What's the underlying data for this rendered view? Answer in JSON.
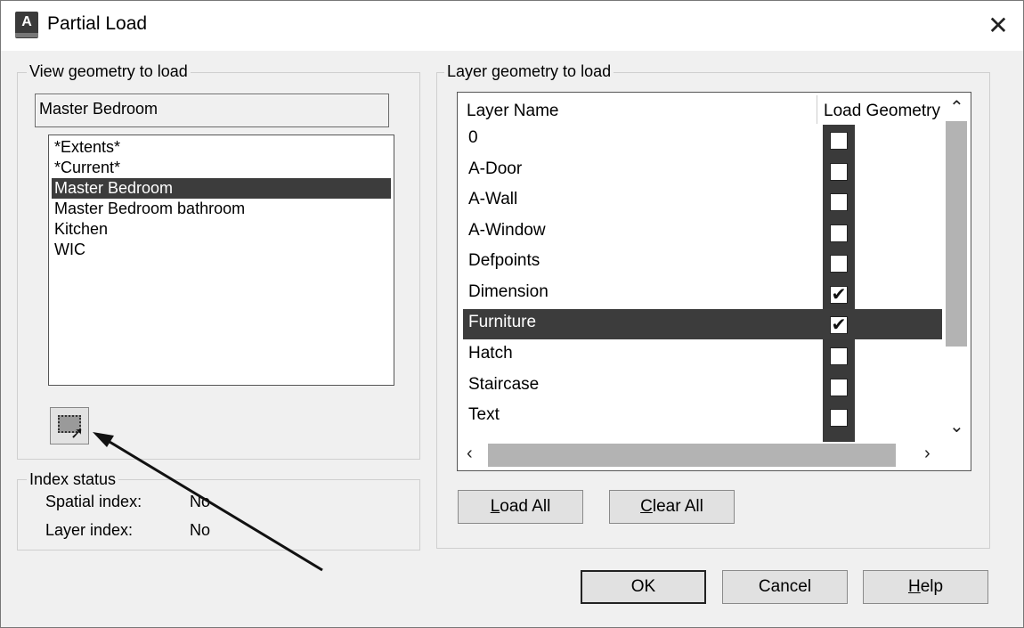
{
  "window": {
    "title": "Partial Load",
    "app_icon_letter": "A",
    "close_glyph": "✕"
  },
  "view_group": {
    "label": "View geometry to load",
    "selected_view": "Master Bedroom",
    "items": [
      {
        "label": "*Extents*",
        "selected": false
      },
      {
        "label": "*Current*",
        "selected": false
      },
      {
        "label": "Master Bedroom",
        "selected": true
      },
      {
        "label": "Master Bedroom bathroom",
        "selected": false
      },
      {
        "label": "Kitchen",
        "selected": false
      },
      {
        "label": "WIC",
        "selected": false
      }
    ],
    "pick_button_icon": "window-select-icon"
  },
  "index_status": {
    "label": "Index status",
    "spatial_label": "Spatial index:",
    "spatial_value": "No",
    "layer_label": "Layer index:",
    "layer_value": "No"
  },
  "layer_group": {
    "label": "Layer geometry to load",
    "col_name": "Layer Name",
    "col_load": "Load Geometry",
    "rows": [
      {
        "name": "0",
        "checked": false,
        "selected": false
      },
      {
        "name": "A-Door",
        "checked": false,
        "selected": false
      },
      {
        "name": "A-Wall",
        "checked": false,
        "selected": false
      },
      {
        "name": "A-Window",
        "checked": false,
        "selected": false
      },
      {
        "name": "Defpoints",
        "checked": false,
        "selected": false
      },
      {
        "name": "Dimension",
        "checked": true,
        "selected": false
      },
      {
        "name": "Furniture",
        "checked": true,
        "selected": true
      },
      {
        "name": "Hatch",
        "checked": false,
        "selected": false
      },
      {
        "name": "Staircase",
        "checked": false,
        "selected": false
      },
      {
        "name": "Text",
        "checked": false,
        "selected": false
      }
    ],
    "load_all_pre": "",
    "load_all_key": "L",
    "load_all_post": "oad All",
    "clear_all_pre": "",
    "clear_all_key": "C",
    "clear_all_post": "lear All"
  },
  "footer": {
    "ok": "OK",
    "cancel": "Cancel",
    "help_key": "H",
    "help_post": "elp"
  },
  "colors": {
    "dialog_bg": "#f0f0f0",
    "selection": "#3c3c3c"
  }
}
